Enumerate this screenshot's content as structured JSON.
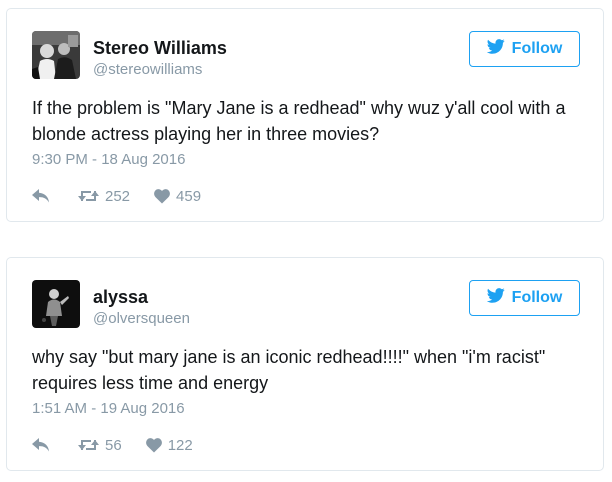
{
  "tweets": [
    {
      "display_name": "Stereo Williams",
      "handle": "@stereowilliams",
      "follow_label": "Follow",
      "text": "If the problem is \"Mary Jane is a redhead\" why wuz y'all cool with a blonde actress playing her in three movies?",
      "timestamp": "9:30 PM - 18 Aug 2016",
      "retweets": "252",
      "likes": "459",
      "avatar_icon": "avatar-photo"
    },
    {
      "display_name": "alyssa",
      "handle": "@olversqueen",
      "follow_label": "Follow",
      "text": "why say \"but mary jane is an iconic redhead!!!!\" when \"i'm racist\" requires less time and energy",
      "timestamp": "1:51 AM - 19 Aug 2016",
      "retweets": "56",
      "likes": "122",
      "avatar_icon": "avatar-photo"
    }
  ],
  "icons": {
    "reply": "reply-icon",
    "retweet": "retweet-icon",
    "like": "heart-icon",
    "follow": "twitter-bird-icon"
  },
  "colors": {
    "accent": "#1da1f2",
    "muted": "#8899a6",
    "text": "#14171a",
    "border": "#e1e8ed"
  }
}
